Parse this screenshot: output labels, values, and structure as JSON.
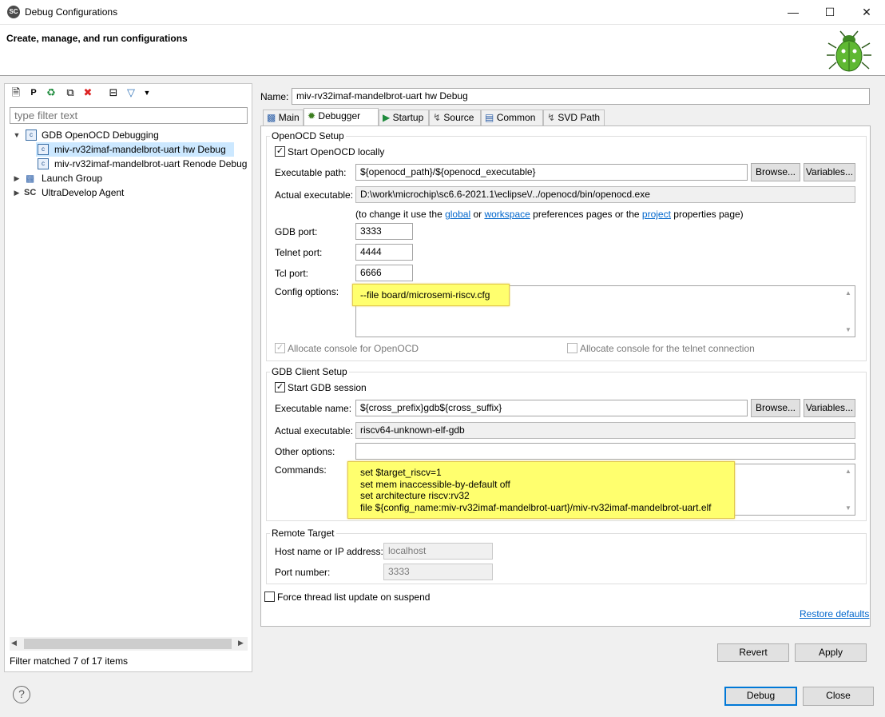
{
  "window": {
    "title": "Debug Configurations",
    "app_icon": "SC"
  },
  "banner": {
    "title": "Create, manage, and run configurations",
    "icon": "bug-icon"
  },
  "left": {
    "filter_placeholder": "type filter text",
    "tree": [
      {
        "label": "GDB OpenOCD Debugging",
        "icon": "c-config-icon",
        "expanded": true
      },
      {
        "label": "miv-rv32imaf-mandelbrot-uart hw Debug",
        "icon": "c-config-icon",
        "selected": true
      },
      {
        "label": "miv-rv32imaf-mandelbrot-uart Renode Debug",
        "icon": "c-config-icon"
      },
      {
        "label": "Launch Group",
        "icon": "launch-group-icon"
      },
      {
        "label": "UltraDevelop Agent",
        "icon": "sc-agent-icon"
      }
    ],
    "status": "Filter matched 7 of 17 items"
  },
  "config": {
    "name_label": "Name:",
    "name_value": "miv-rv32imaf-mandelbrot-uart hw Debug",
    "tabs": [
      "Main",
      "Debugger",
      "Startup",
      "Source",
      "Common",
      "SVD Path"
    ],
    "active_tab": "Debugger"
  },
  "openocd": {
    "group_title": "OpenOCD Setup",
    "start_locally": "Start OpenOCD locally",
    "exe_label": "Executable path:",
    "exe_value": "${openocd_path}/${openocd_executable}",
    "browse": "Browse...",
    "variables": "Variables...",
    "actual_label": "Actual executable:",
    "actual_value": "D:\\work\\microchip\\sc6.6-2021.1\\eclipse\\/../openocd/bin/openocd.exe",
    "hint_pre": "(to change it use the ",
    "hint_global": "global",
    "hint_or": " or ",
    "hint_workspace": "workspace",
    "hint_mid": " preferences pages or the ",
    "hint_project": "project",
    "hint_post": " properties page)",
    "gdb_port_label": "GDB port:",
    "gdb_port": "3333",
    "telnet_port_label": "Telnet port:",
    "telnet_port": "4444",
    "tcl_port_label": "Tcl port:",
    "tcl_port": "6666",
    "config_label": "Config options:",
    "config_value": "--file board/microsemi-riscv.cfg",
    "alloc_console": "Allocate console for OpenOCD",
    "alloc_telnet": "Allocate console for the telnet connection"
  },
  "gdb": {
    "group_title": "GDB Client Setup",
    "start_session": "Start GDB session",
    "exe_label": "Executable name:",
    "exe_value": "${cross_prefix}gdb${cross_suffix}",
    "browse": "Browse...",
    "variables": "Variables...",
    "actual_label": "Actual executable:",
    "actual_value": "riscv64-unknown-elf-gdb",
    "other_label": "Other options:",
    "other_value": "",
    "commands_label": "Commands:",
    "commands": [
      "set $target_riscv=1",
      "set mem inaccessible-by-default off",
      "set architecture riscv:rv32",
      "file ${config_name:miv-rv32imaf-mandelbrot-uart}/miv-rv32imaf-mandelbrot-uart.elf"
    ]
  },
  "remote": {
    "group_title": "Remote Target",
    "host_label": "Host name or IP address:",
    "host_value": "localhost",
    "port_label": "Port number:",
    "port_value": "3333"
  },
  "force_thread": "Force thread list update on suspend",
  "restore_defaults": "Restore defaults",
  "buttons": {
    "revert": "Revert",
    "apply": "Apply",
    "debug": "Debug",
    "close": "Close"
  },
  "colors": {
    "highlight": "#ffff6e",
    "selection": "#cce8ff",
    "link": "#0066cc",
    "primary_border": "#0078d7"
  }
}
